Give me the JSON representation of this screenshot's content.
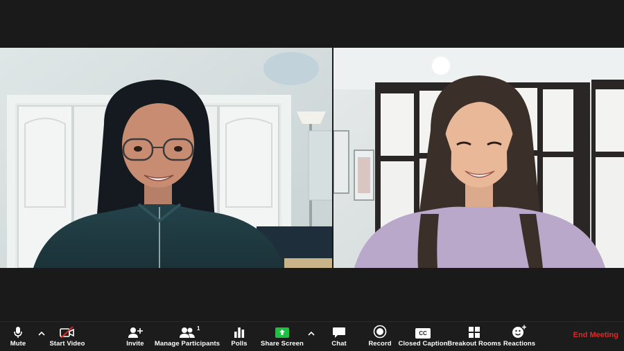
{
  "toolbar": {
    "mute": "Mute",
    "start_video": "Start Video",
    "invite": "Invite",
    "manage_participants": "Manage Participants",
    "participant_count": "1",
    "polls": "Polls",
    "share_screen": "Share Screen",
    "chat": "Chat",
    "record": "Record",
    "closed_caption": "Closed Caption",
    "cc_glyph": "CC",
    "breakout_rooms": "Breakout Rooms",
    "reactions": "Reactions",
    "end_meeting": "End Meeting"
  },
  "colors": {
    "toolbar_bg": "#1c1c1c",
    "share_green": "#1fbf42",
    "end_red": "#e02828",
    "video_off_red": "#e02828"
  },
  "icons": [
    "microphone-icon",
    "video-off-icon",
    "invite-icon",
    "participants-icon",
    "polls-icon",
    "share-screen-icon",
    "chat-icon",
    "record-icon",
    "closed-caption-icon",
    "breakout-rooms-icon",
    "reactions-icon"
  ]
}
